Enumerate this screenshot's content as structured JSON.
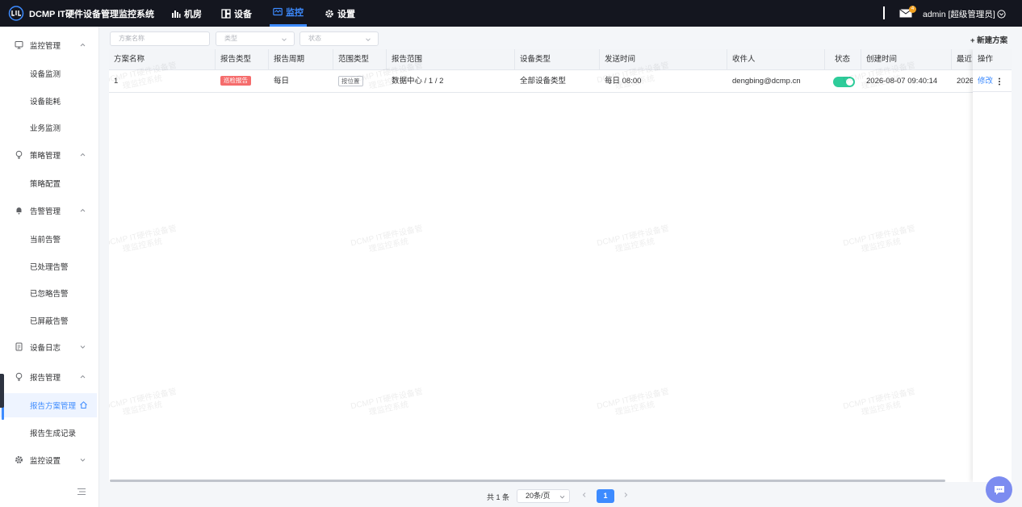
{
  "app": {
    "title": "DCMP IT硬件设备管理监控系统"
  },
  "nav": [
    {
      "label": "机房",
      "icon": "bar-chart-icon"
    },
    {
      "label": "设备",
      "icon": "grid-icon"
    },
    {
      "label": "监控",
      "icon": "monitor-icon",
      "active": true
    },
    {
      "label": "设置",
      "icon": "gear-icon"
    }
  ],
  "header": {
    "mail_badge": "4",
    "user": "admin [超级管理员]"
  },
  "sidebar": {
    "groups": [
      {
        "label": "监控管理",
        "icon": "monitor-icon",
        "expanded": true,
        "items": [
          "设备监测",
          "设备能耗",
          "业务监测"
        ]
      },
      {
        "label": "策略管理",
        "icon": "bulb-icon",
        "expanded": true,
        "items": [
          "策略配置"
        ]
      },
      {
        "label": "告警管理",
        "icon": "bell-icon",
        "expanded": true,
        "items": [
          "当前告警",
          "已处理告警",
          "已忽略告警",
          "已屏蔽告警"
        ]
      },
      {
        "label": "设备日志",
        "icon": "document-icon",
        "expanded": false,
        "items": []
      },
      {
        "label": "报告管理",
        "icon": "bulb-icon",
        "expanded": true,
        "items": [
          "报告方案管理",
          "报告生成记录"
        ]
      },
      {
        "label": "监控设置",
        "icon": "gear-icon",
        "expanded": false,
        "items": []
      }
    ],
    "active_item": "报告方案管理"
  },
  "filters": {
    "name_placeholder": "方案名称",
    "type_placeholder": "类型",
    "status_placeholder": "状态"
  },
  "toolbar": {
    "new_button": "+ 新建方案"
  },
  "table": {
    "columns": [
      "方案名称",
      "报告类型",
      "报告周期",
      "范围类型",
      "报告范围",
      "设备类型",
      "发送时间",
      "收件人",
      "状态",
      "创建时间",
      "最近",
      "操作"
    ],
    "rows": [
      {
        "name": "1",
        "report_type": "巡检报告",
        "cycle": "每日",
        "scope_type": "按位置",
        "scope": "数据中心 / 1 / 2",
        "device_type": "全部设备类型",
        "send_time": "每日 08:00",
        "recipient": "dengbing@dcmp.cn",
        "status_on": true,
        "created": "2026-08-07 09:40:14",
        "recent": "2026",
        "action": "修改"
      }
    ]
  },
  "watermark": {
    "line1": "DCMP IT硬件设备管",
    "line2": "理监控系统"
  },
  "pagination": {
    "total": "共 1 条",
    "page_size": "20条/页",
    "current_page": "1"
  },
  "colors": {
    "accent": "#3d8bff",
    "topbar": "#14161f",
    "toggle_on": "#2ecc9a",
    "tag_red": "#f56c6c"
  }
}
